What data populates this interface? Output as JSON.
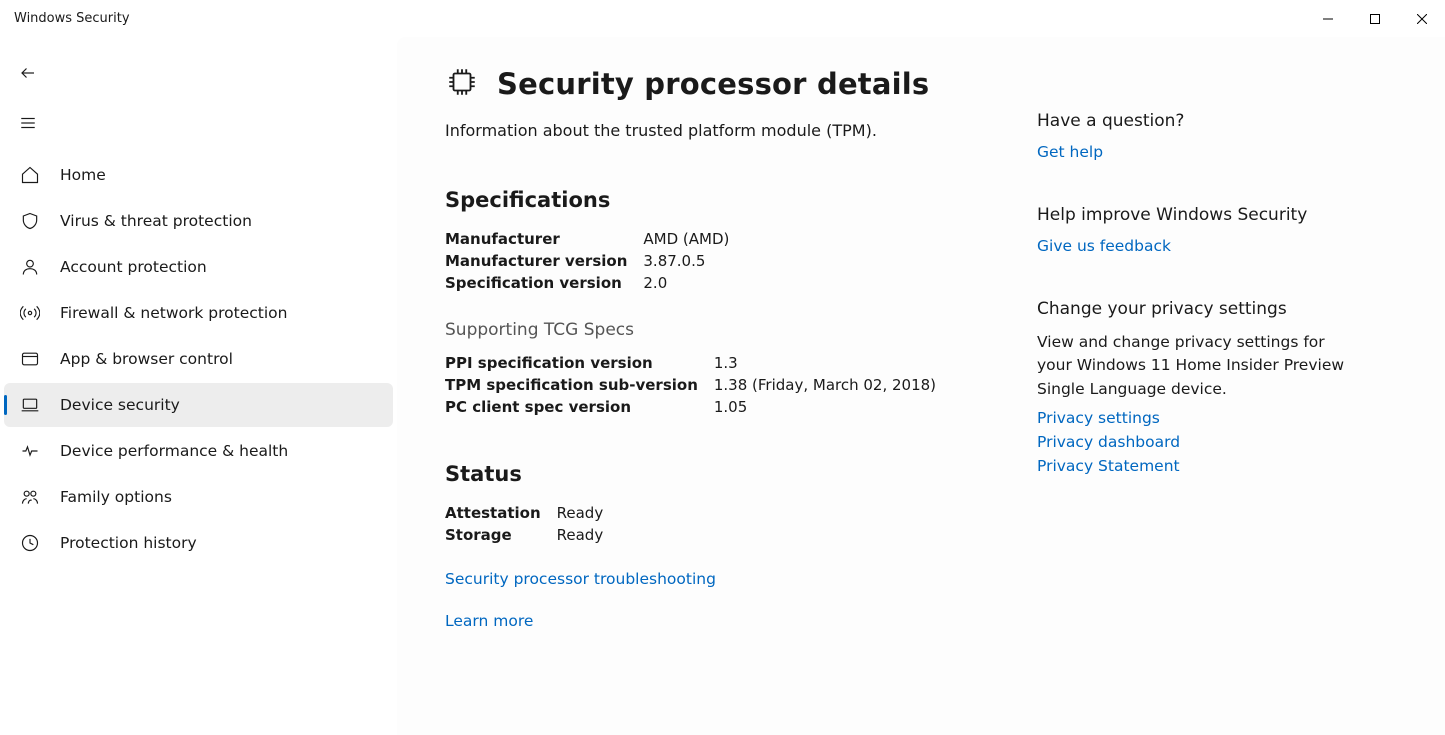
{
  "window_title": "Windows Security",
  "sidebar": {
    "items": [
      {
        "id": "home",
        "label": "Home"
      },
      {
        "id": "virus",
        "label": "Virus & threat protection"
      },
      {
        "id": "account",
        "label": "Account protection"
      },
      {
        "id": "firewall",
        "label": "Firewall & network protection"
      },
      {
        "id": "appbrowser",
        "label": "App & browser control"
      },
      {
        "id": "device",
        "label": "Device security"
      },
      {
        "id": "performance",
        "label": "Device performance & health"
      },
      {
        "id": "family",
        "label": "Family options"
      },
      {
        "id": "history",
        "label": "Protection history"
      }
    ]
  },
  "page": {
    "title": "Security processor details",
    "subtitle": "Information about the trusted platform module (TPM).",
    "specs_heading": "Specifications",
    "specs": [
      {
        "k": "Manufacturer",
        "v": "AMD (AMD)"
      },
      {
        "k": "Manufacturer version",
        "v": "3.87.0.5"
      },
      {
        "k": "Specification version",
        "v": "2.0"
      }
    ],
    "tcg_heading": "Supporting TCG Specs",
    "tcg": [
      {
        "k": "PPI specification version",
        "v": "1.3"
      },
      {
        "k": "TPM specification sub-version",
        "v": "1.38 (Friday, March 02, 2018)"
      },
      {
        "k": "PC client spec version",
        "v": "1.05"
      }
    ],
    "status_heading": "Status",
    "status": [
      {
        "k": "Attestation",
        "v": "Ready"
      },
      {
        "k": "Storage",
        "v": "Ready"
      }
    ],
    "link_troubleshoot": "Security processor troubleshooting",
    "link_learn": "Learn more"
  },
  "right": {
    "q_title": "Have a question?",
    "q_link": "Get help",
    "improve_title": "Help improve Windows Security",
    "improve_link": "Give us feedback",
    "privacy_title": "Change your privacy settings",
    "privacy_text": "View and change privacy settings for your Windows 11 Home Insider Preview Single Language device.",
    "privacy_links": [
      "Privacy settings",
      "Privacy dashboard",
      "Privacy Statement"
    ]
  }
}
